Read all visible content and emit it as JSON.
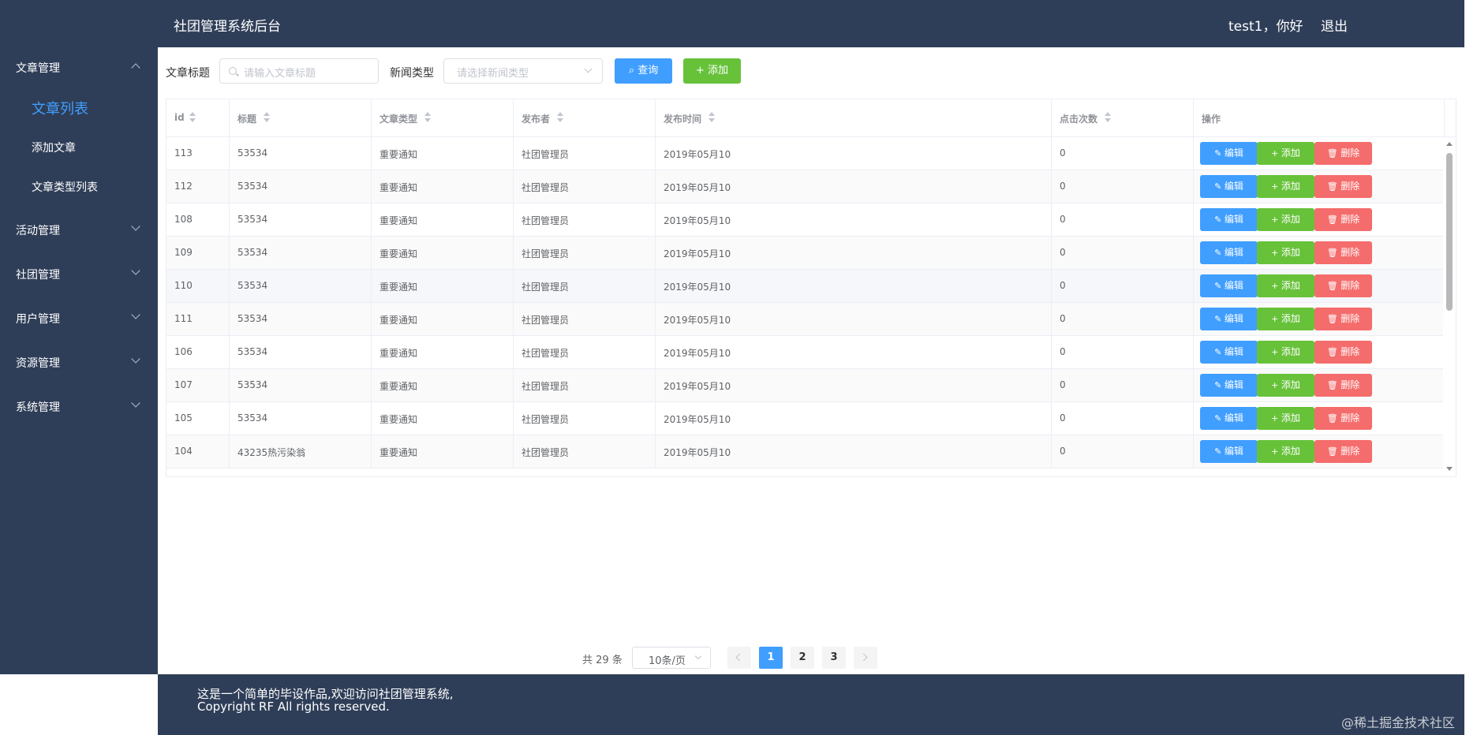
{
  "header": {
    "title": "社团管理系统后台",
    "user_greeting": "test1，你好",
    "logout_label": "退出"
  },
  "sidebar": {
    "menus": [
      {
        "label": "文章管理",
        "expanded": true
      },
      {
        "label": "活动管理",
        "expanded": false
      },
      {
        "label": "社团管理",
        "expanded": false
      },
      {
        "label": "用户管理",
        "expanded": false
      },
      {
        "label": "资源管理",
        "expanded": false
      },
      {
        "label": "系统管理",
        "expanded": false
      }
    ],
    "submenu": [
      {
        "label": "文章列表",
        "active": true
      },
      {
        "label": "添加文章",
        "active": false
      },
      {
        "label": "文章类型列表",
        "active": false
      }
    ]
  },
  "toolbar": {
    "title_label": "文章标题",
    "title_placeholder": "请输入文章标题",
    "type_label": "新闻类型",
    "type_placeholder": "请选择新闻类型",
    "search_label": "查询",
    "add_label": "添加"
  },
  "table": {
    "columns": [
      "id",
      "标题",
      "文章类型",
      "发布者",
      "发布时间",
      "点击次数",
      "操作"
    ],
    "rows": [
      {
        "id": "113",
        "title": "53534",
        "type": "重要通知",
        "publisher": "社团管理员",
        "time": "2019年05月10",
        "clicks": "0"
      },
      {
        "id": "112",
        "title": "53534",
        "type": "重要通知",
        "publisher": "社团管理员",
        "time": "2019年05月10",
        "clicks": "0"
      },
      {
        "id": "108",
        "title": "53534",
        "type": "重要通知",
        "publisher": "社团管理员",
        "time": "2019年05月10",
        "clicks": "0"
      },
      {
        "id": "109",
        "title": "53534",
        "type": "重要通知",
        "publisher": "社团管理员",
        "time": "2019年05月10",
        "clicks": "0"
      },
      {
        "id": "110",
        "title": "53534",
        "type": "重要通知",
        "publisher": "社团管理员",
        "time": "2019年05月10",
        "clicks": "0"
      },
      {
        "id": "111",
        "title": "53534",
        "type": "重要通知",
        "publisher": "社团管理员",
        "time": "2019年05月10",
        "clicks": "0"
      },
      {
        "id": "106",
        "title": "53534",
        "type": "重要通知",
        "publisher": "社团管理员",
        "time": "2019年05月10",
        "clicks": "0"
      },
      {
        "id": "107",
        "title": "53534",
        "type": "重要通知",
        "publisher": "社团管理员",
        "time": "2019年05月10",
        "clicks": "0"
      },
      {
        "id": "105",
        "title": "53534",
        "type": "重要通知",
        "publisher": "社团管理员",
        "time": "2019年05月10",
        "clicks": "0"
      },
      {
        "id": "104",
        "title": "43235热污染翁",
        "type": "重要通知",
        "publisher": "社团管理员",
        "time": "2019年05月10",
        "clicks": "0"
      }
    ],
    "action_labels": {
      "edit": "编辑",
      "add": "添加",
      "delete": "删除"
    }
  },
  "pagination": {
    "total_text": "共 29 条",
    "page_size": "10条/页",
    "pages": [
      "1",
      "2",
      "3"
    ],
    "current": "1"
  },
  "footer": {
    "line1": "这是一个简单的毕设作品,欢迎访问社团管理系统,",
    "line2": "Copyright RF All rights reserved."
  },
  "watermark": "@稀土掘金技术社区"
}
